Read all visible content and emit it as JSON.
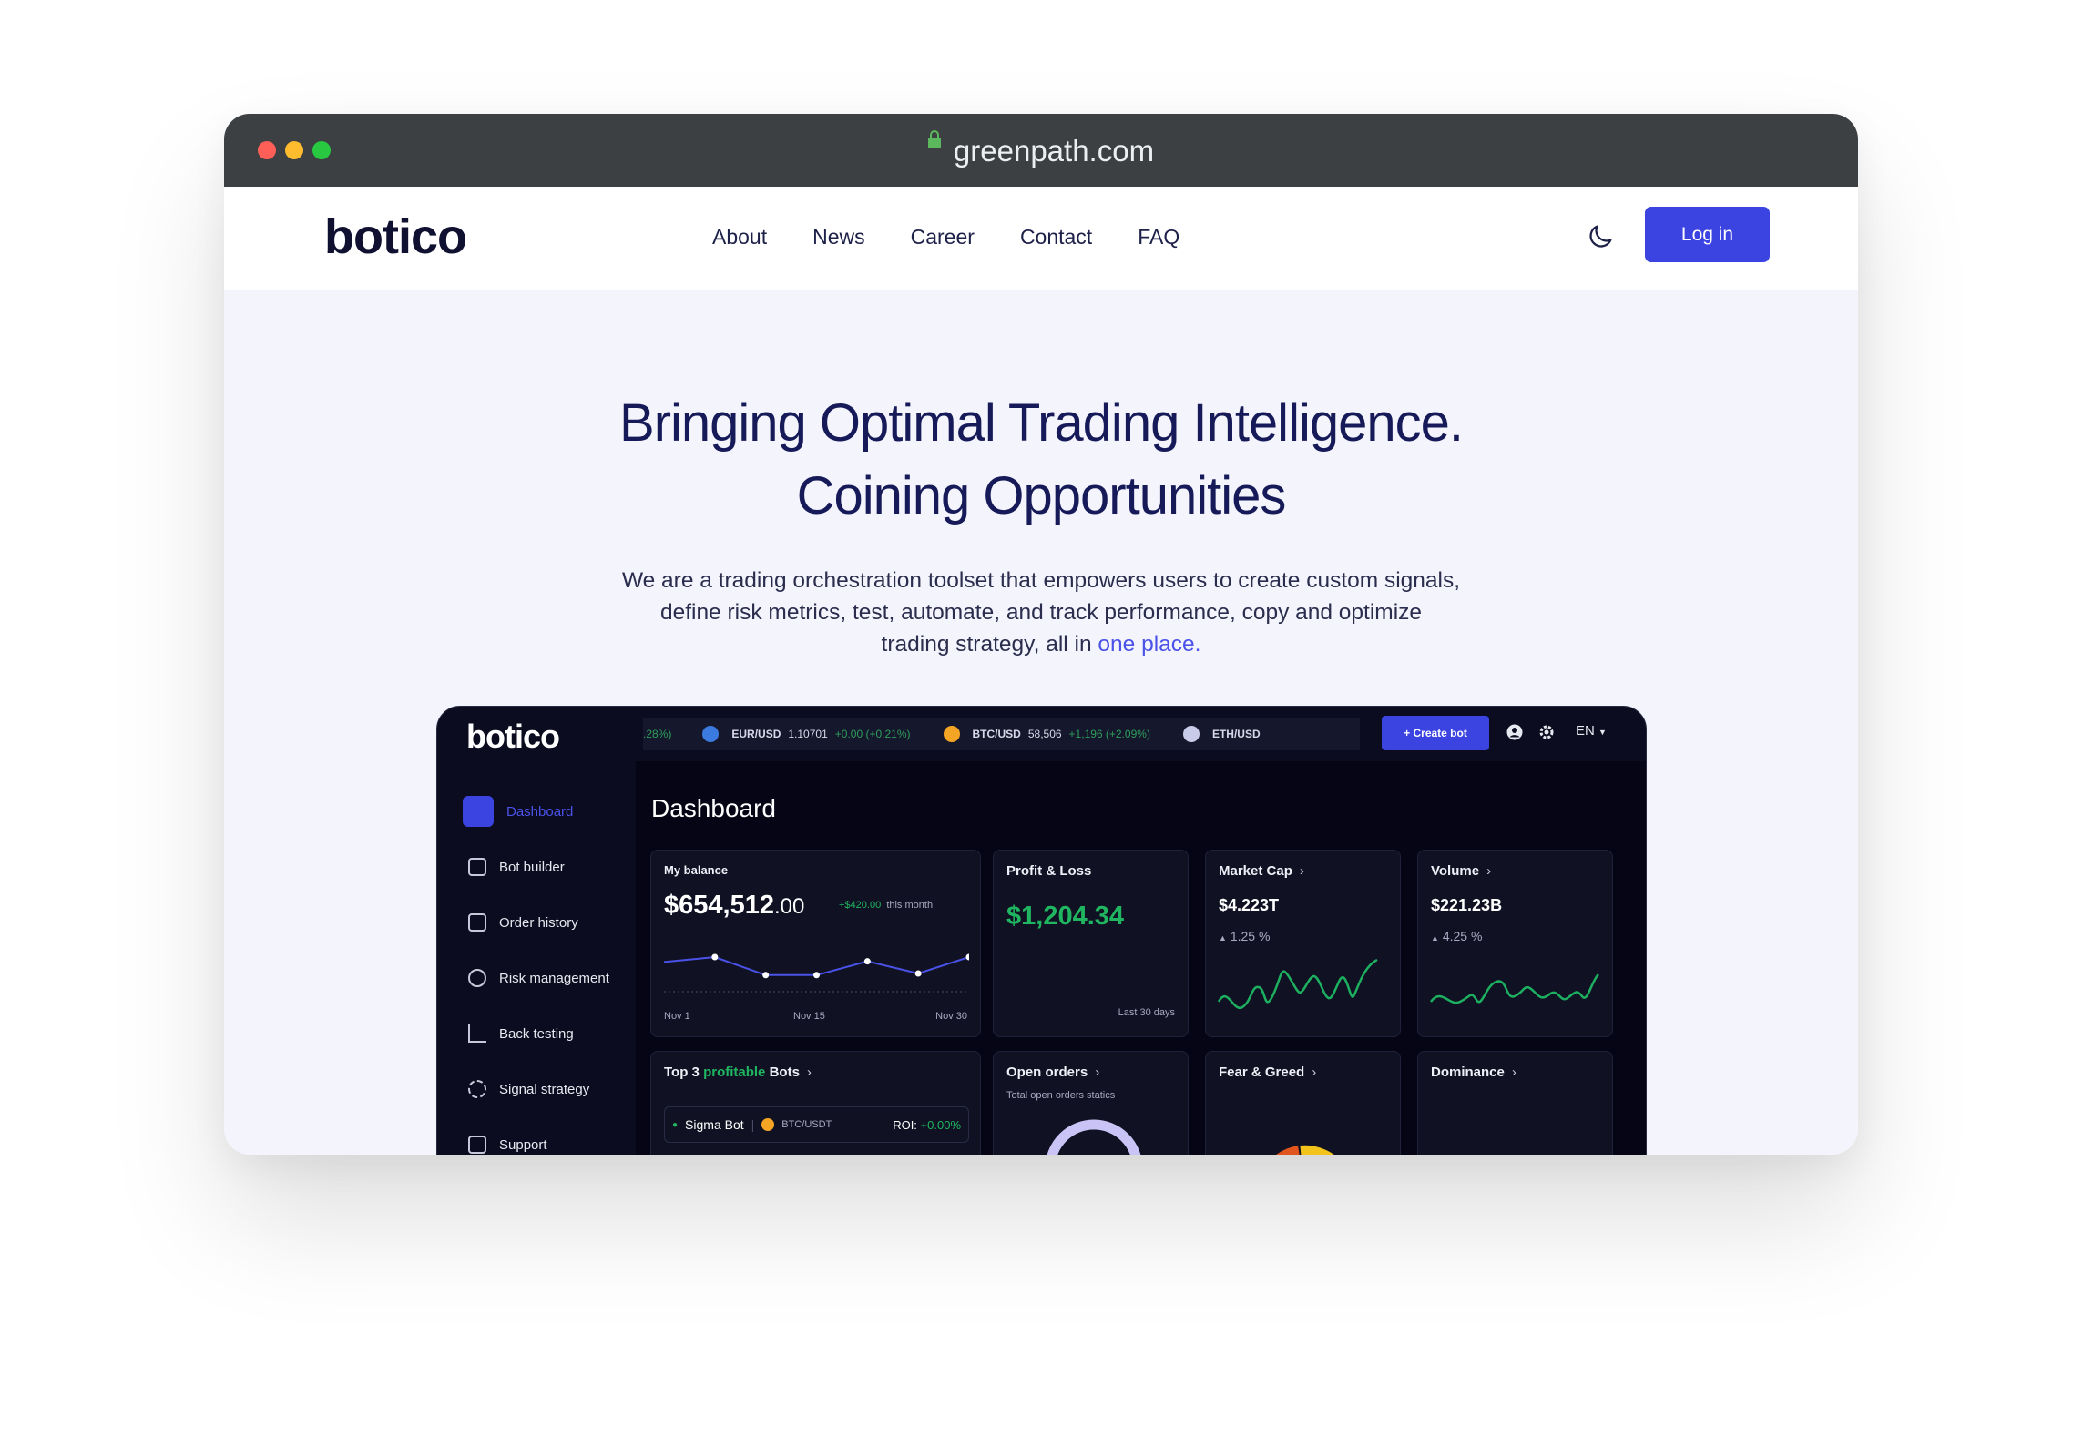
{
  "browser": {
    "url": "greenpath.com"
  },
  "site": {
    "logo": "botico",
    "nav": [
      "About",
      "News",
      "Career",
      "Contact",
      "FAQ"
    ],
    "login_label": "Log in"
  },
  "hero": {
    "title_line1": "Bringing Optimal Trading Intelligence.",
    "title_line2": "Coining Opportunities",
    "desc_line1": "We are a trading orchestration toolset that empowers users to create custom signals,",
    "desc_line2": "define risk metrics, test, automate, and track performance, copy and optimize",
    "desc_line3": "trading strategy, all in ",
    "desc_highlight": "one place."
  },
  "dashboard": {
    "logo": "botico",
    "ticker": [
      {
        "pair": "EUR/USD",
        "price": "1.10701",
        "change": "+0.00 (+0.21%)",
        "color": "#3b7be0"
      },
      {
        "pair": "BTC/USD",
        "price": "58,506",
        "change": "+1,196 (+2.09%)",
        "color": "#f5a524"
      },
      {
        "pair": "ETH/USD",
        "price": "",
        "change": "",
        "color": "#c8cce8"
      }
    ],
    "ticker_lead": ".28%)",
    "create_bot_label": "+ Create bot",
    "lang": "EN",
    "sidebar": [
      "Dashboard",
      "Bot builder",
      "Order history",
      "Risk management",
      "Back testing",
      "Signal strategy",
      "Support"
    ],
    "title": "Dashboard",
    "balance": {
      "title": "My balance",
      "value": "$654,512",
      "cents": ".00",
      "change": "+$420.00",
      "period": "this month",
      "x_labels": [
        "Nov 1",
        "Nov 15",
        "Nov 30"
      ],
      "points": [
        0.6,
        0.75,
        0.2,
        0.2,
        0.62,
        0.25,
        0.75
      ]
    },
    "pnl": {
      "title": "Profit & Loss",
      "value": "$1,204.34",
      "period": "Last 30 days"
    },
    "market_cap": {
      "title": "Market Cap",
      "value": "$4.223T",
      "change": "1.25 %"
    },
    "volume": {
      "title": "Volume",
      "value": "$221.23B",
      "change": "4.25 %"
    },
    "top_bots": {
      "title_a": "Top 3 ",
      "title_b": "profitable",
      "title_c": " Bots",
      "bot": "Sigma Bot",
      "pair": "BTC/USDT",
      "roi_label": "ROI:",
      "roi": "+0.00%"
    },
    "open_orders": {
      "title": "Open orders",
      "sub": "Total open orders statics"
    },
    "fear_greed": {
      "title": "Fear & Greed"
    },
    "dominance": {
      "title": "Dominance"
    }
  }
}
